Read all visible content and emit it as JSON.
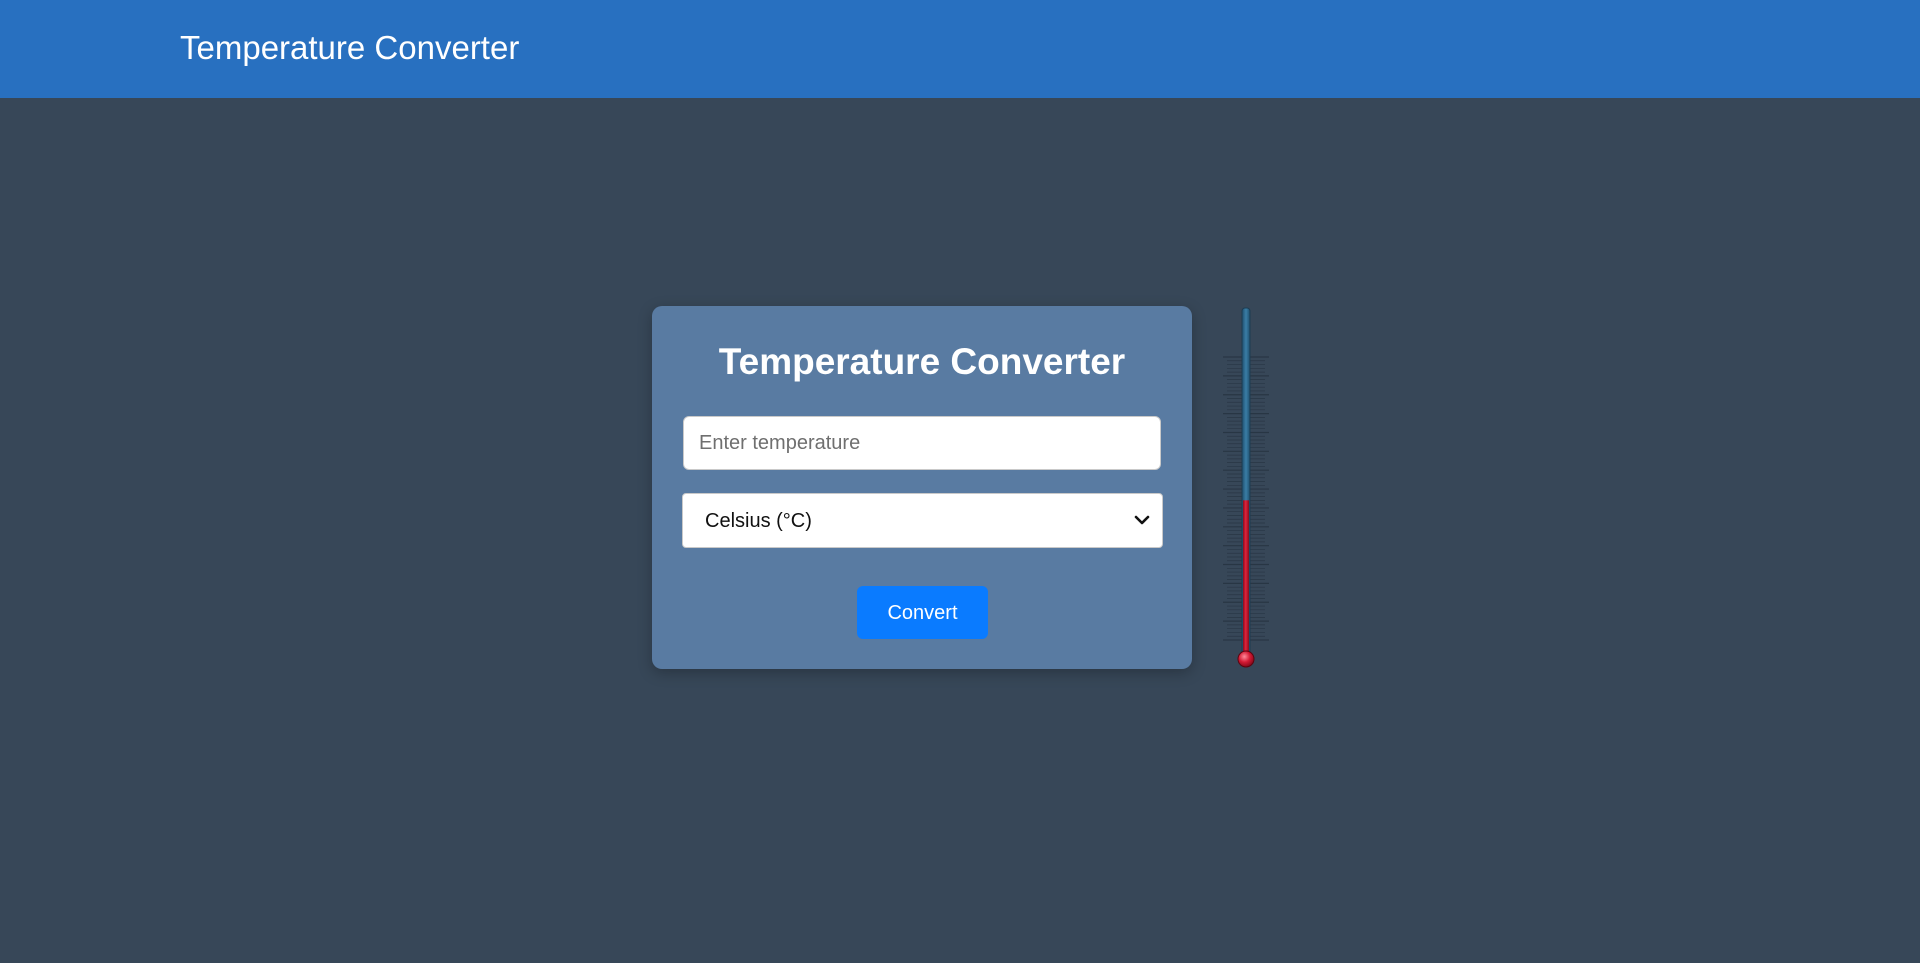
{
  "header": {
    "title": "Temperature Converter"
  },
  "converter": {
    "title": "Temperature Converter",
    "input": {
      "value": "",
      "placeholder": "Enter temperature"
    },
    "unit_select": {
      "selected": "Celsius (°C)"
    },
    "convert_label": "Convert"
  },
  "thermometer": {
    "fill_fraction": 0.45,
    "icon": "thermometer-icon"
  },
  "colors": {
    "header_bg": "#2870c0",
    "page_bg": "#374758",
    "card_bg": "#597ba2",
    "button_bg": "#0a7bff",
    "mercury": "#c8102e",
    "tube": "#2a6a8e"
  }
}
